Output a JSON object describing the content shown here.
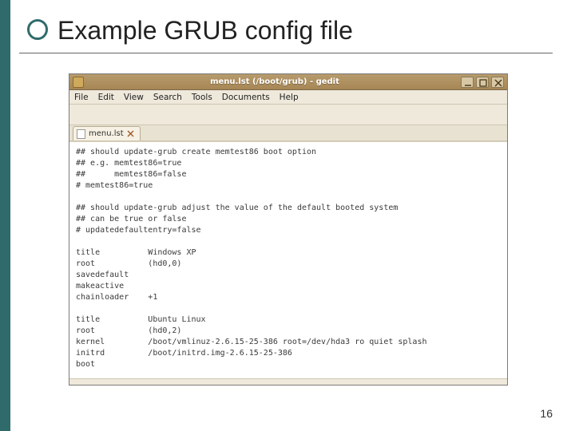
{
  "slide": {
    "title": "Example GRUB config file",
    "page_number": "16"
  },
  "window": {
    "title": "menu.lst (/boot/grub) - gedit"
  },
  "menubar": {
    "items": [
      "File",
      "Edit",
      "View",
      "Search",
      "Tools",
      "Documents",
      "Help"
    ]
  },
  "tab": {
    "label": "menu.lst"
  },
  "editor": {
    "text": "## should update-grub create memtest86 boot option\n## e.g. memtest86=true\n##      memtest86=false\n# memtest86=true\n\n## should update-grub adjust the value of the default booted system\n## can be true or false\n# updatedefaultentry=false\n\ntitle          Windows XP\nroot           (hd0,0)\nsavedefault\nmakeactive\nchainloader    +1\n\ntitle          Ubuntu Linux\nroot           (hd0,2)\nkernel         /boot/vmlinuz-2.6.15-25-386 root=/dev/hda3 ro quiet splash\ninitrd         /boot/initrd.img-2.6.15-25-386\nboot"
  }
}
